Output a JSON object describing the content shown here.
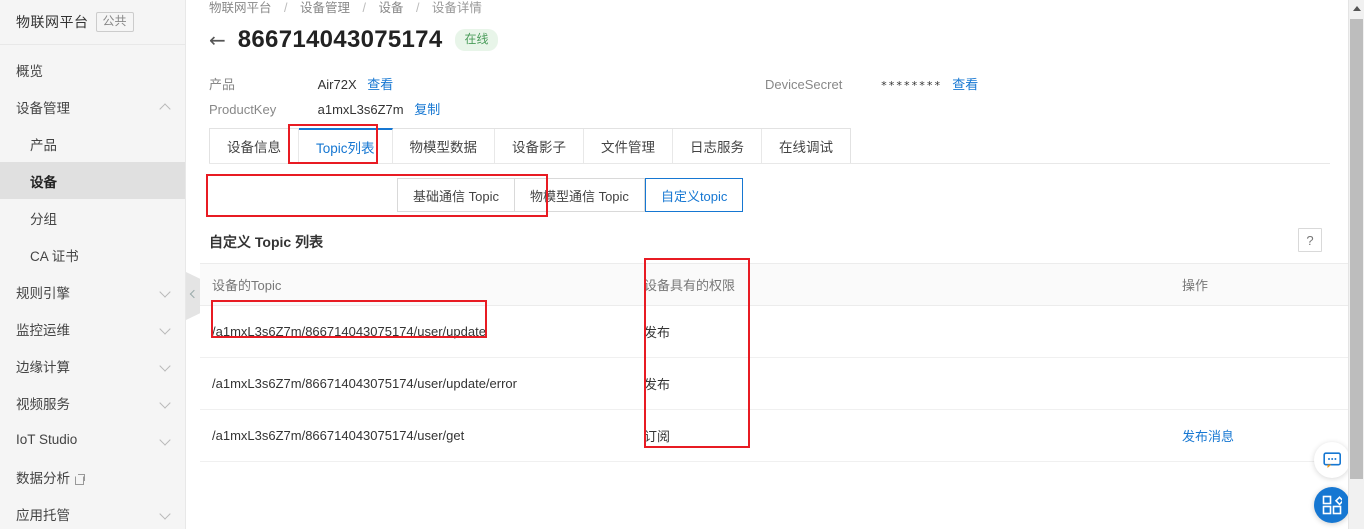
{
  "sidebar": {
    "brand": {
      "text": "物联网平台",
      "badge": "公共"
    },
    "items": [
      {
        "label": "概览",
        "icon": "",
        "level": 0,
        "expandable": false,
        "active": false
      },
      {
        "label": "设备管理",
        "icon": "chevron-up-icon",
        "level": 0,
        "expandable": true,
        "active": false
      },
      {
        "label": "产品",
        "icon": "",
        "level": 1,
        "expandable": false,
        "active": false
      },
      {
        "label": "设备",
        "icon": "",
        "level": 1,
        "expandable": false,
        "active": true
      },
      {
        "label": "分组",
        "icon": "",
        "level": 1,
        "expandable": false,
        "active": false
      },
      {
        "label": "CA 证书",
        "icon": "",
        "level": 1,
        "expandable": false,
        "active": false
      },
      {
        "label": "规则引擎",
        "icon": "chevron-down-icon",
        "level": 0,
        "expandable": true,
        "active": false
      },
      {
        "label": "监控运维",
        "icon": "chevron-down-icon",
        "level": 0,
        "expandable": true,
        "active": false
      },
      {
        "label": "边缘计算",
        "icon": "chevron-down-icon",
        "level": 0,
        "expandable": true,
        "active": false
      },
      {
        "label": "视频服务",
        "icon": "chevron-down-icon",
        "level": 0,
        "expandable": true,
        "active": false
      },
      {
        "label": "IoT Studio",
        "icon": "chevron-down-icon",
        "level": 0,
        "expandable": true,
        "active": false
      },
      {
        "label": "数据分析",
        "icon": "external-link-icon",
        "level": 0,
        "expandable": false,
        "active": false
      },
      {
        "label": "应用托管",
        "icon": "chevron-down-icon",
        "level": 0,
        "expandable": true,
        "active": false
      }
    ]
  },
  "breadcrumb": [
    {
      "label": "物联网平台"
    },
    {
      "label": "设备管理"
    },
    {
      "label": "设备"
    },
    {
      "label": "设备详情"
    }
  ],
  "header": {
    "back_icon": "←",
    "device_id": "866714043075174",
    "status": "在线",
    "status_color": "#4a9c5a",
    "status_bg": "#e8f5e9"
  },
  "meta": {
    "product_label": "产品",
    "product_value": "Air72X",
    "product_link": "查看",
    "productkey_label": "ProductKey",
    "productkey_value": "a1mxL3s6Z7m",
    "productkey_link": "复制",
    "secret_label": "DeviceSecret",
    "secret_value": "********",
    "secret_link": "查看"
  },
  "tabs": [
    {
      "label": "设备信息",
      "active": false
    },
    {
      "label": "Topic列表",
      "active": true
    },
    {
      "label": "物模型数据",
      "active": false
    },
    {
      "label": "设备影子",
      "active": false
    },
    {
      "label": "文件管理",
      "active": false
    },
    {
      "label": "日志服务",
      "active": false
    },
    {
      "label": "在线调试",
      "active": false
    }
  ],
  "subtabs": [
    {
      "label": "基础通信 Topic",
      "active": false
    },
    {
      "label": "物模型通信 Topic",
      "active": false
    },
    {
      "label": "自定义topic",
      "active": true
    }
  ],
  "section": {
    "title": "自定义 Topic 列表",
    "help_icon": "?"
  },
  "table": {
    "columns": [
      "设备的Topic",
      "设备具有的权限",
      "操作"
    ],
    "rows": [
      {
        "topic": "/a1mxL3s6Z7m/866714043075174/user/update",
        "permission": "发布",
        "action": ""
      },
      {
        "topic": "/a1mxL3s6Z7m/866714043075174/user/update/error",
        "permission": "发布",
        "action": ""
      },
      {
        "topic": "/a1mxL3s6Z7m/866714043075174/user/get",
        "permission": "订阅",
        "action": "发布消息"
      }
    ]
  },
  "annotations": {
    "color": "#e81b23",
    "boxes": [
      "active-tab",
      "subtab-group",
      "first-topic-row",
      "permission-column"
    ]
  },
  "floating": {
    "chat_icon": "chat-bubble-icon",
    "apps_icon": "app-grid-icon",
    "apps_color": "#1677d2"
  },
  "accent": {
    "blue": "#1677d2",
    "link": "#1677d2"
  }
}
